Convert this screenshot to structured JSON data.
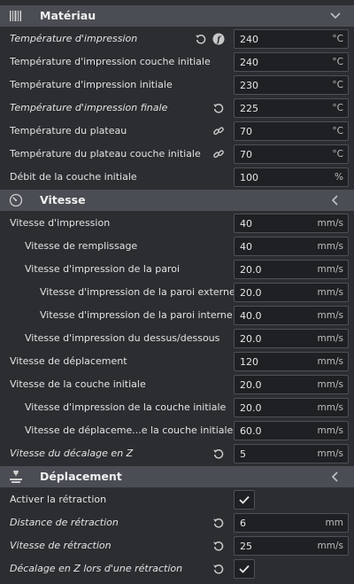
{
  "colors": {
    "header_bg": "#4a4d53",
    "panel_bg": "#2b2d31",
    "field_bg": "#1f2023",
    "field_border": "#4d5056"
  },
  "sections": {
    "materiau": {
      "title": "Matériau",
      "icon": "spool-icon",
      "chevron": "chevron-down-icon"
    },
    "vitesse": {
      "title": "Vitesse",
      "icon": "speedometer-icon",
      "chevron": "chevron-left-icon"
    },
    "deplacement": {
      "title": "Déplacement",
      "icon": "travel-icon",
      "chevron": "chevron-left-icon"
    }
  },
  "materiau": {
    "print_temp": {
      "label": "Température d'impression",
      "value": "240",
      "unit": "°C"
    },
    "print_temp_initial_layer": {
      "label": "Température d'impression couche initiale",
      "value": "240",
      "unit": "°C"
    },
    "print_temp_initial": {
      "label": "Température d'impression initiale",
      "value": "230",
      "unit": "°C"
    },
    "print_temp_final": {
      "label": "Température d'impression finale",
      "value": "225",
      "unit": "°C"
    },
    "bed_temp": {
      "label": "Température du plateau",
      "value": "70",
      "unit": "°C"
    },
    "bed_temp_initial_layer": {
      "label": "Température du plateau couche initiale",
      "value": "70",
      "unit": "°C"
    },
    "flow_initial_layer": {
      "label": "Débit de la couche initiale",
      "value": "100",
      "unit": "%"
    }
  },
  "vitesse": {
    "print_speed": {
      "label": "Vitesse d'impression",
      "value": "40",
      "unit": "mm/s"
    },
    "infill_speed": {
      "label": "Vitesse de remplissage",
      "value": "40",
      "unit": "mm/s"
    },
    "wall_speed": {
      "label": "Vitesse d'impression de la paroi",
      "value": "20.0",
      "unit": "mm/s"
    },
    "wall_outer_speed": {
      "label": "Vitesse d'impression de la paroi externe",
      "value": "20.0",
      "unit": "mm/s"
    },
    "wall_inner_speed": {
      "label": "Vitesse d'impression de la paroi interne",
      "value": "40.0",
      "unit": "mm/s"
    },
    "topbottom_speed": {
      "label": "Vitesse d'impression du dessus/dessous",
      "value": "20.0",
      "unit": "mm/s"
    },
    "travel_speed": {
      "label": "Vitesse de déplacement",
      "value": "120",
      "unit": "mm/s"
    },
    "initial_layer_speed": {
      "label": "Vitesse de la couche initiale",
      "value": "20.0",
      "unit": "mm/s"
    },
    "initial_layer_print_speed": {
      "label": "Vitesse d'impression de la couche initiale",
      "value": "20.0",
      "unit": "mm/s"
    },
    "initial_layer_travel_speed": {
      "label": "Vitesse de déplaceme...e la couche initiale",
      "value": "60.0",
      "unit": "mm/s"
    },
    "z_hop_speed": {
      "label": "Vitesse du décalage en Z",
      "value": "5",
      "unit": "mm/s"
    }
  },
  "deplacement": {
    "retraction_enable": {
      "label": "Activer la rétraction",
      "checked": true
    },
    "retraction_distance": {
      "label": "Distance de rétraction",
      "value": "6",
      "unit": "mm"
    },
    "retraction_speed": {
      "label": "Vitesse de rétraction",
      "value": "25",
      "unit": "mm/s"
    },
    "z_hop_when_retracted": {
      "label": "Décalage en Z lors d'une rétraction",
      "checked": true
    }
  }
}
